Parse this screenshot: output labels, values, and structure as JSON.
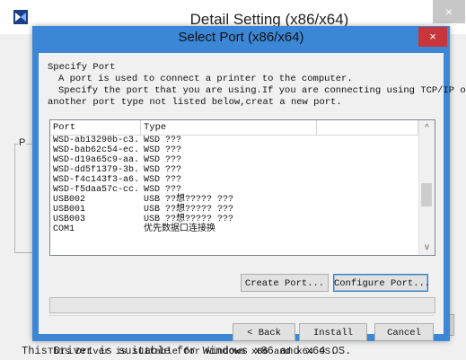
{
  "background_window": {
    "title": "Detail Setting (x86/x64)",
    "close_glyph": "×",
    "group_label": "P",
    "footer": "This Driver is suitable for Windows x86 and x64 OS."
  },
  "dialog": {
    "title": "Select Port (x86/x64)",
    "close_glyph": "×",
    "heading": "Specify Port",
    "desc_line1": "A port is used to connect a printer to the computer.",
    "desc_line2": "Specify the port that you are using.If you are connecting using TCP/IP or",
    "desc_line3": "another port type not listed below,creat a new port.",
    "columns": [
      "Port",
      "Type"
    ],
    "rows": [
      {
        "port": "WSD-ab13290b-c3...",
        "type": "WSD ???"
      },
      {
        "port": "WSD-bab62c54-ec...",
        "type": "WSD ???"
      },
      {
        "port": "WSD-d19a65c9-aa...",
        "type": "WSD ???"
      },
      {
        "port": "WSD-dd5f1379-3b...",
        "type": "WSD ???"
      },
      {
        "port": "WSD-f4c143f3-a6...",
        "type": "WSD ???"
      },
      {
        "port": "WSD-f5daa57c-cc...",
        "type": "WSD ???"
      },
      {
        "port": "USB002",
        "type": "USB ??想????? ???"
      },
      {
        "port": "USB001",
        "type": "USB ??想????? ???"
      },
      {
        "port": "USB003",
        "type": "USB ??想????? ???"
      },
      {
        "port": "COM1",
        "type": "优先数据口连接换"
      }
    ],
    "create_port": "Create Port...",
    "configure_port": "Configure Port...",
    "back": "< Back",
    "install": "Install",
    "cancel": "Cancel",
    "footer": "This Driver is suitable for Windows x86 and x64 OS.",
    "scroll_up_glyph": "^",
    "scroll_down_glyph": "v",
    "progress_fraction": 0
  },
  "colors": {
    "dialog_frame": "#3c86d6",
    "close_button": "#c8353b"
  }
}
